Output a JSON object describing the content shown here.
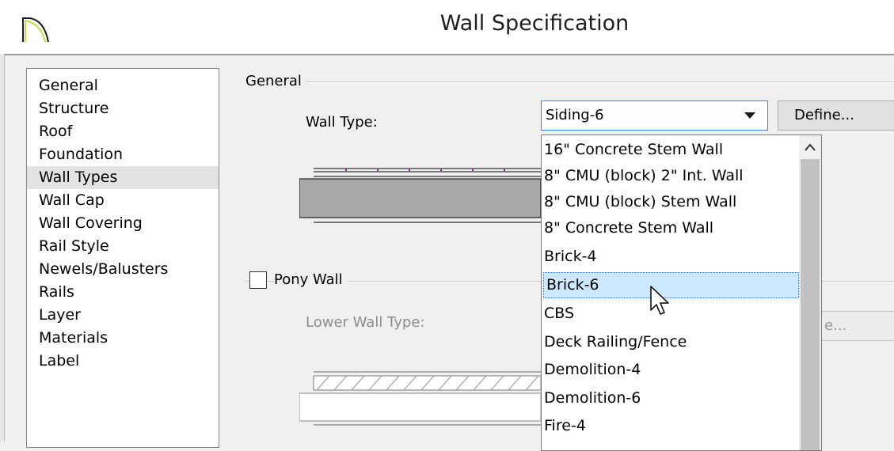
{
  "window": {
    "title": "Wall Specification"
  },
  "nav": {
    "items": [
      {
        "label": "General"
      },
      {
        "label": "Structure"
      },
      {
        "label": "Roof"
      },
      {
        "label": "Foundation"
      },
      {
        "label": "Wall Types"
      },
      {
        "label": "Wall Cap"
      },
      {
        "label": "Wall Covering"
      },
      {
        "label": "Rail Style"
      },
      {
        "label": "Newels/Balusters"
      },
      {
        "label": "Rails"
      },
      {
        "label": "Layer"
      },
      {
        "label": "Materials"
      },
      {
        "label": "Label"
      }
    ],
    "selected": "Wall Types"
  },
  "general_group": {
    "label": "General",
    "wall_type_label": "Wall Type:",
    "wall_type_value": "Siding-6",
    "define_label": "Define..."
  },
  "pony_group": {
    "label": "Pony Wall",
    "checked": false,
    "lower_wall_type_label": "Lower Wall Type:",
    "define_label_partial": "e..."
  },
  "dropdown": {
    "items": [
      {
        "label": "16\" Concrete Stem Wall"
      },
      {
        "label": "8\" CMU (block) 2\" Int. Wall"
      },
      {
        "label": "8\" CMU (block) Stem Wall"
      },
      {
        "label": "8\" Concrete Stem Wall"
      },
      {
        "label": "Brick-4"
      },
      {
        "label": "Brick-6"
      },
      {
        "label": "CBS"
      },
      {
        "label": "Deck Railing/Fence"
      },
      {
        "label": "Demolition-4"
      },
      {
        "label": "Demolition-6"
      },
      {
        "label": "Fire-4"
      }
    ],
    "highlighted": "Brick-6"
  },
  "colors": {
    "accent": "#3b84d6",
    "highlight": "#cce8ff",
    "wall_fill": "#a8a8a8"
  }
}
